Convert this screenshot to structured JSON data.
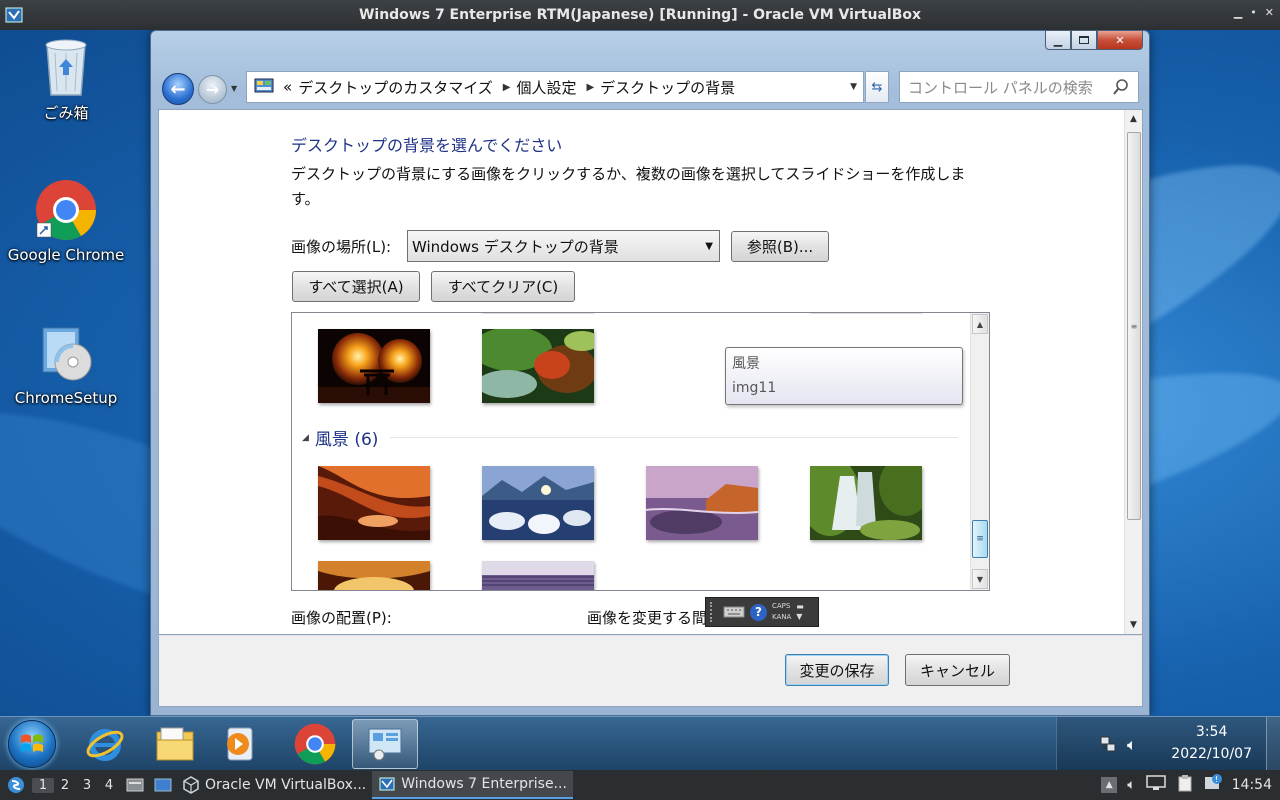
{
  "host": {
    "title": "Windows 7 Enterprise RTM(Japanese) [Running] - Oracle VM VirtualBox",
    "controls": [
      "•",
      "✕"
    ],
    "workspaces": [
      "1",
      "2",
      "3",
      "4"
    ],
    "tasks": [
      "Oracle VM VirtualBox...",
      "Windows 7 Enterprise..."
    ],
    "clock": "14:54"
  },
  "desktop": {
    "icons": [
      "ごみ箱",
      "Google Chrome",
      "ChromeSetup"
    ]
  },
  "window": {
    "breadcrumb": {
      "prefix": "«",
      "segments": [
        "デスクトップのカスタマイズ",
        "個人設定",
        "デスクトップの背景"
      ]
    },
    "search_placeholder": "コントロール パネルの検索",
    "heading": "デスクトップの背景を選んでください",
    "description": "デスクトップの背景にする画像をクリックするか、複数の画像を選択してスライドショーを作成します。",
    "location_label": "画像の場所(L):",
    "location_value": "Windows デスクトップの背景",
    "browse_button": "参照(B)...",
    "select_all_button": "すべて選択(A)",
    "clear_all_button": "すべてクリア(C)",
    "tooltip": {
      "line1": "風景",
      "line2": "img11"
    },
    "group_header": "風景 (6)",
    "position_label": "画像の配置(P):",
    "change_label": "画像を変更する間",
    "ime": {
      "caps": "CAPS",
      "kana": "KANA"
    },
    "save_button": "変更の保存",
    "cancel_button": "キャンセル"
  },
  "taskbar": {
    "time": "3:54",
    "date": "2022/10/07"
  }
}
